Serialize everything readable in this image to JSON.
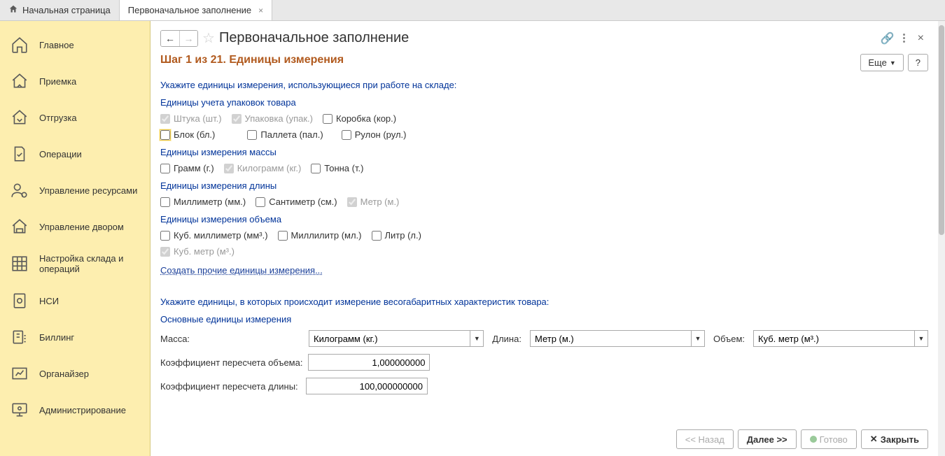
{
  "tabs": {
    "home": "Начальная страница",
    "active": "Первоначальное заполнение"
  },
  "sidebar": {
    "items": [
      {
        "label": "Главное"
      },
      {
        "label": "Приемка"
      },
      {
        "label": "Отгрузка"
      },
      {
        "label": "Операции"
      },
      {
        "label": "Управление ресурсами"
      },
      {
        "label": "Управление двором"
      },
      {
        "label": "Настройка склада и операций"
      },
      {
        "label": "НСИ"
      },
      {
        "label": "Биллинг"
      },
      {
        "label": "Органайзер"
      },
      {
        "label": "Администрирование"
      }
    ]
  },
  "header": {
    "title": "Первоначальное заполнение",
    "more": "Еще",
    "help": "?"
  },
  "step": {
    "title": "Шаг 1 из 21. Единицы измерения"
  },
  "text": {
    "instr1": "Укажите единицы измерения, использующиеся при работе на складе:",
    "sec_pack": "Единицы учета упаковок товара",
    "sec_mass": "Единицы измерения массы",
    "sec_len": "Единицы измерения длины",
    "sec_vol": "Единицы измерения объема",
    "create_other": "Создать прочие единицы измерения...",
    "instr2": "Укажите единицы, в которых происходит измерение весогабаритных характеристик товара:",
    "sec_main": "Основные единицы измерения"
  },
  "checks": {
    "shtuka": "Штука (шт.)",
    "upakovka": "Упаковка (упак.)",
    "korobka": "Коробка (кор.)",
    "blok": "Блок (бл.)",
    "palleta": "Паллета (пал.)",
    "rulon": "Рулон (рул.)",
    "gramm": "Грамм (г.)",
    "kilogramm": "Килограмм (кг.)",
    "tonna": "Тонна (т.)",
    "millimeter": "Миллиметр (мм.)",
    "santimeter": "Сантиметр (см.)",
    "metr": "Метр (м.)",
    "kubmm": "Куб. миллиметр (мм³.)",
    "milliliter": "Миллилитр (мл.)",
    "litr": "Литр (л.)",
    "kubmetr": "Куб. метр (м³.)"
  },
  "form": {
    "mass_label": "Масса:",
    "mass_value": "Килограмм (кг.)",
    "len_label": "Длина:",
    "len_value": "Метр (м.)",
    "vol_label": "Объем:",
    "vol_value": "Куб. метр (м³.)",
    "koef_vol_label": "Коэффициент пересчета объема:",
    "koef_vol_value": "1,000000000",
    "koef_len_label": "Коэффициент пересчета длины:",
    "koef_len_value": "100,000000000"
  },
  "footer": {
    "back": "<< Назад",
    "next": "Далее >>",
    "done": "Готово",
    "close": "Закрыть"
  }
}
